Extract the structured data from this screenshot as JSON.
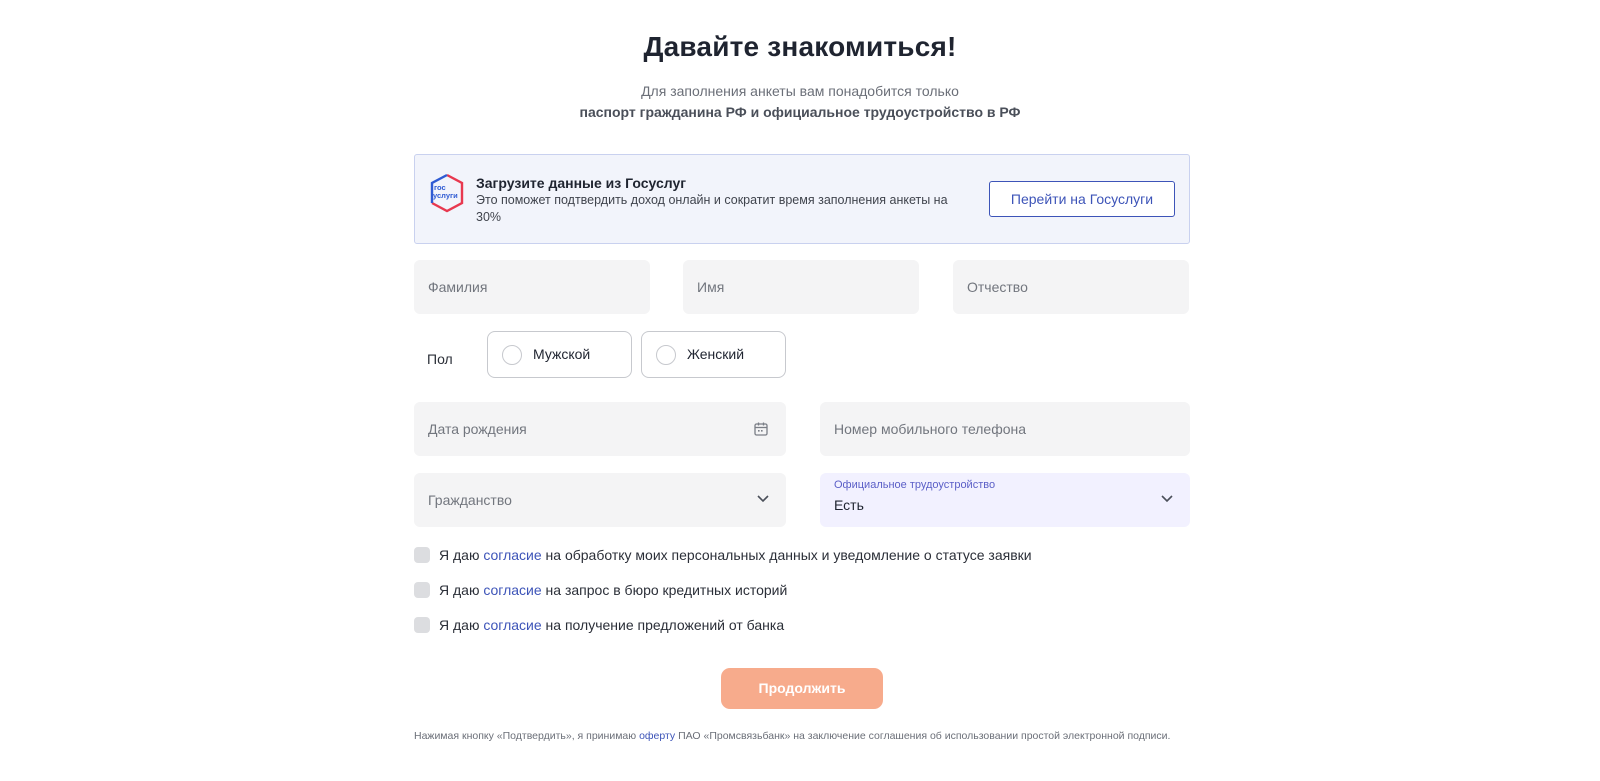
{
  "header": {
    "title": "Давайте знакомиться!",
    "subtitle_line1": "Для заполнения анкеты вам понадобится только",
    "subtitle_line2": "паспорт гражданина РФ и официальное трудоустройство в РФ"
  },
  "gosuslugi": {
    "logo_line1": "гос",
    "logo_line2": "услуги",
    "title": "Загрузите данные из Госуслуг",
    "description": "Это поможет подтвердить доход онлайн и сократит время заполнения анкеты на 30%",
    "button_label": "Перейти на Госуслуги"
  },
  "form": {
    "lastname_placeholder": "Фамилия",
    "firstname_placeholder": "Имя",
    "middlename_placeholder": "Отчество",
    "gender": {
      "label": "Пол",
      "male": "Мужской",
      "female": "Женский"
    },
    "birthdate_placeholder": "Дата рождения",
    "phone_placeholder": "Номер мобильного телефона",
    "citizenship_placeholder": "Гражданство",
    "employment": {
      "label": "Официальное трудоустройство",
      "value": "Есть"
    }
  },
  "consents": [
    {
      "prefix": "Я даю ",
      "link": "согласие",
      "suffix": " на обработку моих персональных данных и уведомление о статусе заявки"
    },
    {
      "prefix": "Я даю ",
      "link": "согласие",
      "suffix": " на запрос в бюро кредитных историй"
    },
    {
      "prefix": "Я даю ",
      "link": "согласие",
      "suffix": " на получение предложений от банка"
    }
  ],
  "continue_label": "Продолжить",
  "legal": {
    "prefix": "Нажимая кнопку «Подтвердить», я принимаю ",
    "link": "оферту",
    "suffix": " ПАО «Промсвязьбанк» на заключение соглашения об использовании простой электронной подписи."
  },
  "colors": {
    "accent_blue": "#3d54b8",
    "button_orange": "#f7ab8c",
    "employment_bg": "#f2f1ff"
  },
  "icons": {
    "birthdate": "calendar-icon",
    "select": "chevron-down-icon"
  }
}
